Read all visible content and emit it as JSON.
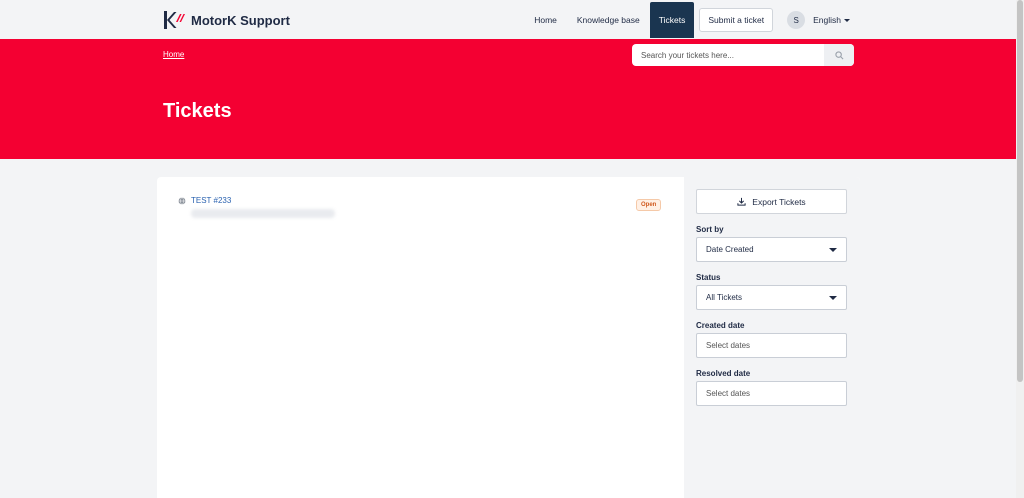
{
  "header": {
    "brand": "MotorK Support",
    "nav": {
      "home": "Home",
      "knowledge_base": "Knowledge base",
      "tickets": "Tickets",
      "submit": "Submit a ticket"
    },
    "avatar_initial": "S",
    "language": "English"
  },
  "hero": {
    "breadcrumb": "Home",
    "search_placeholder": "Search your tickets here...",
    "title": "Tickets"
  },
  "tickets": [
    {
      "title": "TEST #233",
      "status": "Open"
    }
  ],
  "sidebar": {
    "export_label": "Export Tickets",
    "sort_label": "Sort by",
    "sort_value": "Date Created",
    "status_label": "Status",
    "status_value": "All Tickets",
    "created_label": "Created date",
    "created_placeholder": "Select dates",
    "resolved_label": "Resolved date",
    "resolved_placeholder": "Select dates"
  },
  "colors": {
    "brand_red": "#f40032",
    "nav_active": "#1a3550",
    "link_blue": "#2a62b0",
    "badge_orange": "#d05a1f"
  }
}
